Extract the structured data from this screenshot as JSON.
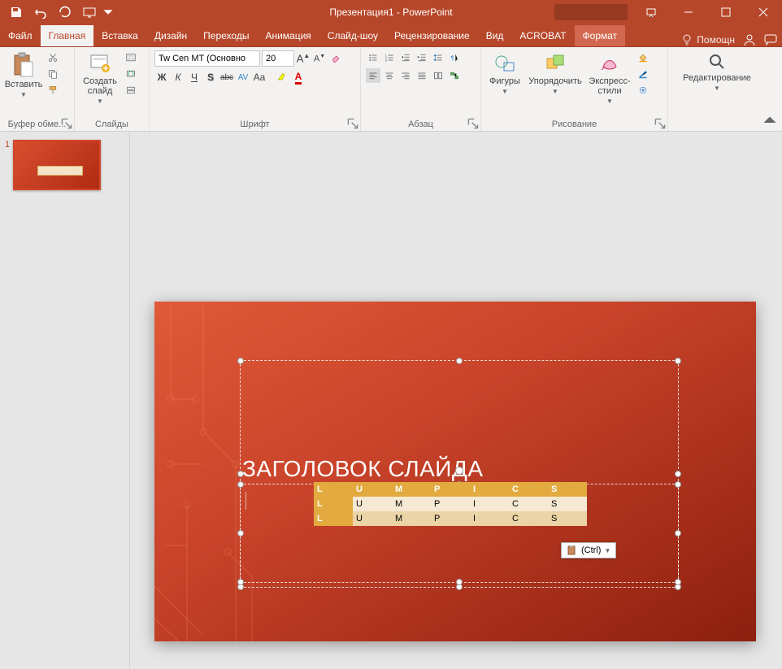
{
  "window": {
    "title": "Презентация1 - PowerPoint"
  },
  "tabs": {
    "file": "Файл",
    "home": "Главная",
    "insert": "Вставка",
    "design": "Дизайн",
    "transitions": "Переходы",
    "animation": "Анимация",
    "slideshow": "Слайд-шоу",
    "review": "Рецензирование",
    "view": "Вид",
    "acrobat": "ACROBAT",
    "format": "Формат",
    "tell_me": "Помощн"
  },
  "groups": {
    "clipboard": {
      "label": "Буфер обме...",
      "paste": "Вставить"
    },
    "slides": {
      "label": "Слайды",
      "new_slide": "Создать\nслайд"
    },
    "font": {
      "label": "Шрифт",
      "name": "Tw Cen MT (Основно",
      "size": "20",
      "bold": "Ж",
      "italic": "К",
      "underline": "Ч",
      "shadow": "S",
      "strike": "abc",
      "spacing": "AV",
      "case": "Aa"
    },
    "paragraph": {
      "label": "Абзац"
    },
    "drawing": {
      "label": "Рисование",
      "shapes": "Фигуры",
      "arrange": "Упорядочить",
      "quick_styles": "Экспресс-\nстили"
    },
    "editing": {
      "label": "Редактирование"
    }
  },
  "thumbnails": {
    "first_num": "1"
  },
  "slide": {
    "title": "ЗАГОЛОВОК СЛАЙДА",
    "table": {
      "header": [
        "L",
        "U",
        "M",
        "P",
        "I",
        "C",
        "S"
      ],
      "rows": [
        [
          "L",
          "U",
          "M",
          "P",
          "I",
          "C",
          "S"
        ],
        [
          "L",
          "U",
          "M",
          "P",
          "I",
          "C",
          "S"
        ]
      ]
    },
    "paste_options": "(Ctrl)"
  }
}
